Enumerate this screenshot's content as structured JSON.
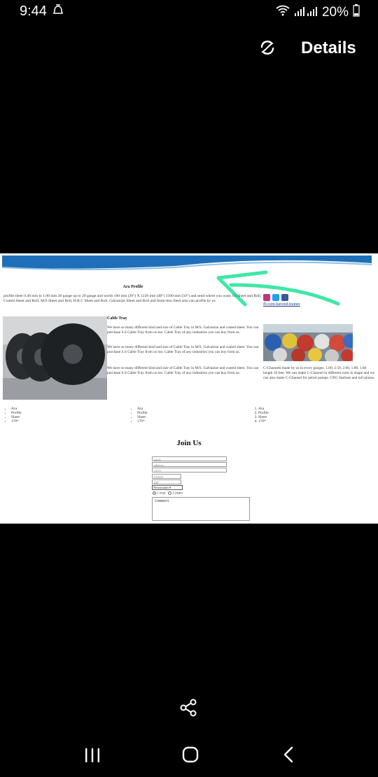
{
  "status_bar": {
    "time": "9:44",
    "battery": "20%"
  },
  "top_bar": {
    "details_label": "Details"
  },
  "page": {
    "heading": "Ara Profile",
    "intro": "profile sheet 0.40 mm to 1.00 mm 28 gauge up to 20 gauge and worth 100 mm (39\") X 1220 mm (48\") 1500 mm (50\") and send where you want. Gi Sheet and Roll, Coated Sheet and Roll, M/S Sheet and Roll, H.R.C Sheet and Roll, Galvanize Sheet and Roll and Stain-less Steel also can profile by us",
    "fb_link": "fb.com/naveed.trainer",
    "cable_tray_title": "Cable Tray",
    "cable_tray_paragraphs": [
      "We have so many different kind and size of Cable Tray in M/S. Galvanize and coated sheet. You can purchase S.S Cable Tray from us too. Cable Tray of any industries you can buy from us.",
      "We have so many different kind and size of Cable Tray in M/S. Galvanize and coated sheet. You can purchase S.S Cable Tray from us too. Cable Tray of any industries you can buy from us.",
      "We have so many different kind and size of Cable Tray in M/S. Galvanize and coated sheet. You can purchase S.S Cable Tray from us too. Cable Tray of any industries you can buy from us."
    ],
    "c_channel_text": "C-Channels made by us in every gauges. 1.00, 2.50, 2.00, 1.80, 1.60 length 10 feet. We can make C-Channel in different sizes in shape and we can also make C-Channel for petrol pumps. CNG Stations and toll plazas.",
    "lists": [
      [
        "Ara",
        "Profile",
        "Sheet",
        "170*"
      ],
      [
        "Ara",
        "Profile",
        "Sheet",
        "170*"
      ],
      [
        "Ara",
        "Profile",
        "Sheet",
        "170*"
      ]
    ],
    "join_title": "Join Us",
    "form": {
      "name_placeholder": "name",
      "address_placeholder": "address",
      "city_placeholder": "CITY",
      "state_placeholder": "STATE",
      "zip_placeholder": "ZIP",
      "select_value": "Newsmonth",
      "radio_1": "1 year",
      "radio_2": "2 years",
      "comment_value": "Comment"
    }
  },
  "colors": {
    "banner_blue": "#1e6fb8",
    "annotation_green": "#3ee8a6"
  }
}
